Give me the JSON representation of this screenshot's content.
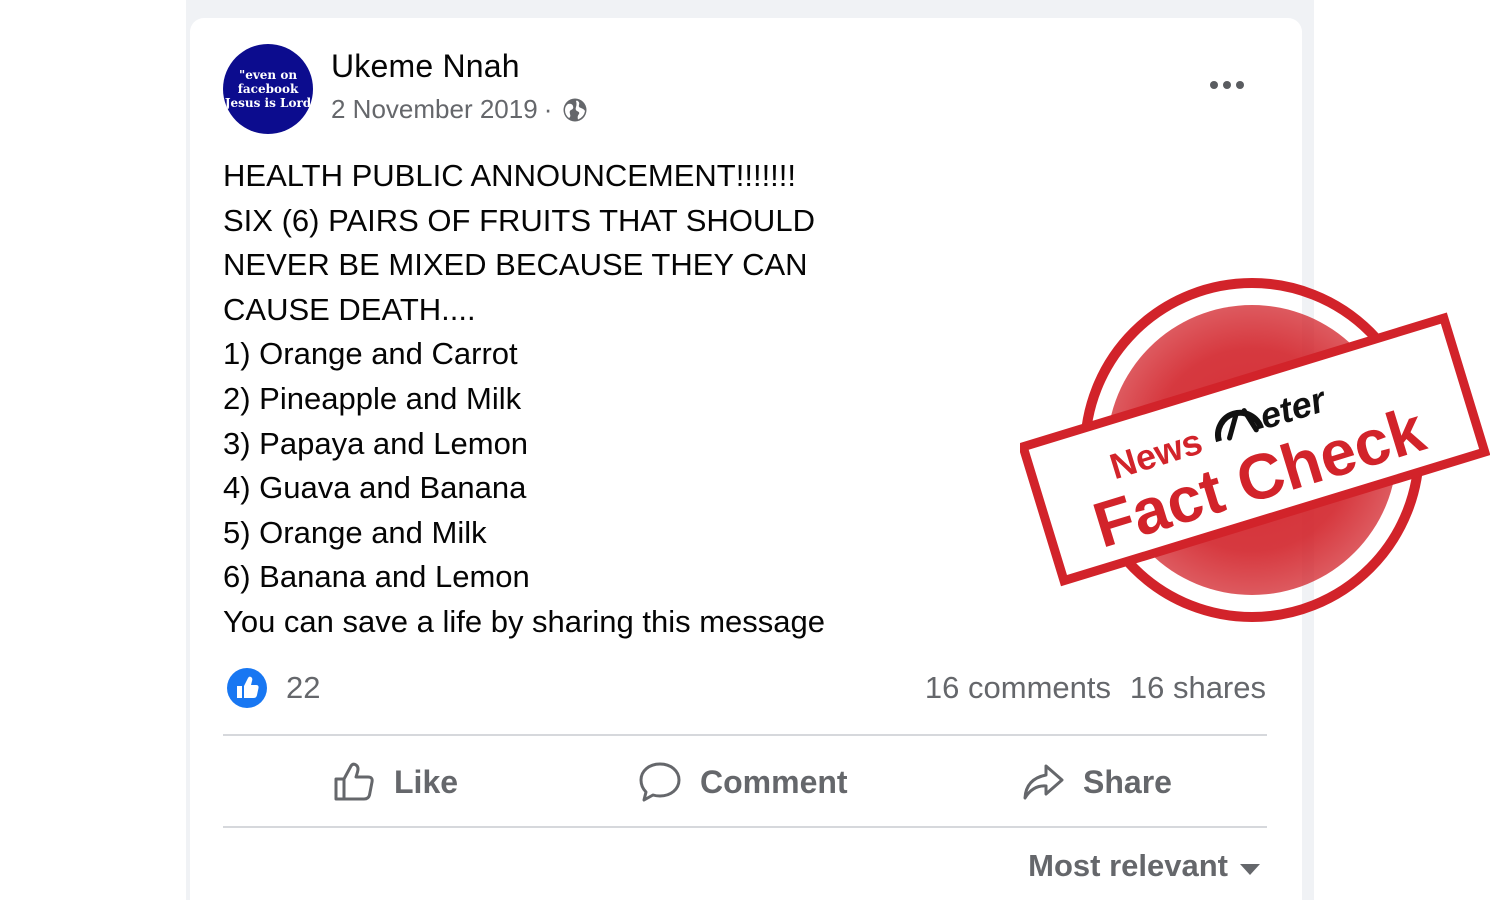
{
  "post": {
    "avatar_lines": [
      "\"even on",
      "facebook",
      "Jesus is Lord"
    ],
    "author": "Ukeme Nnah",
    "date": "2 November 2019",
    "separator": "·",
    "privacy_icon": "globe-icon",
    "text_lines": [
      "HEALTH PUBLIC ANNOUNCEMENT!!!!!!!",
      "SIX (6) PAIRS OF FRUITS THAT SHOULD",
      "NEVER BE MIXED BECAUSE THEY CAN",
      "CAUSE DEATH....",
      "1) Orange and Carrot",
      "2) Pineapple and Milk",
      "3) Papaya and Lemon",
      "4) Guava and Banana",
      "5) Orange and Milk",
      "6) Banana and Lemon",
      "You can save a life by sharing this message"
    ]
  },
  "stats": {
    "reaction_icon": "like-reaction-icon",
    "reactions": "22",
    "comments": "16 comments",
    "shares": "16 shares"
  },
  "actions": {
    "like": "Like",
    "comment": "Comment",
    "share": "Share"
  },
  "sort": {
    "label": "Most relevant"
  },
  "stamp": {
    "brand_news": "News",
    "brand_meter": "eter",
    "label": "Fact Check",
    "color": "#d2232a"
  },
  "colors": {
    "page_bg": "#f0f2f5",
    "card_bg": "#ffffff",
    "text_primary": "#050505",
    "text_secondary": "#65676b",
    "like_blue": "#1877f2"
  }
}
